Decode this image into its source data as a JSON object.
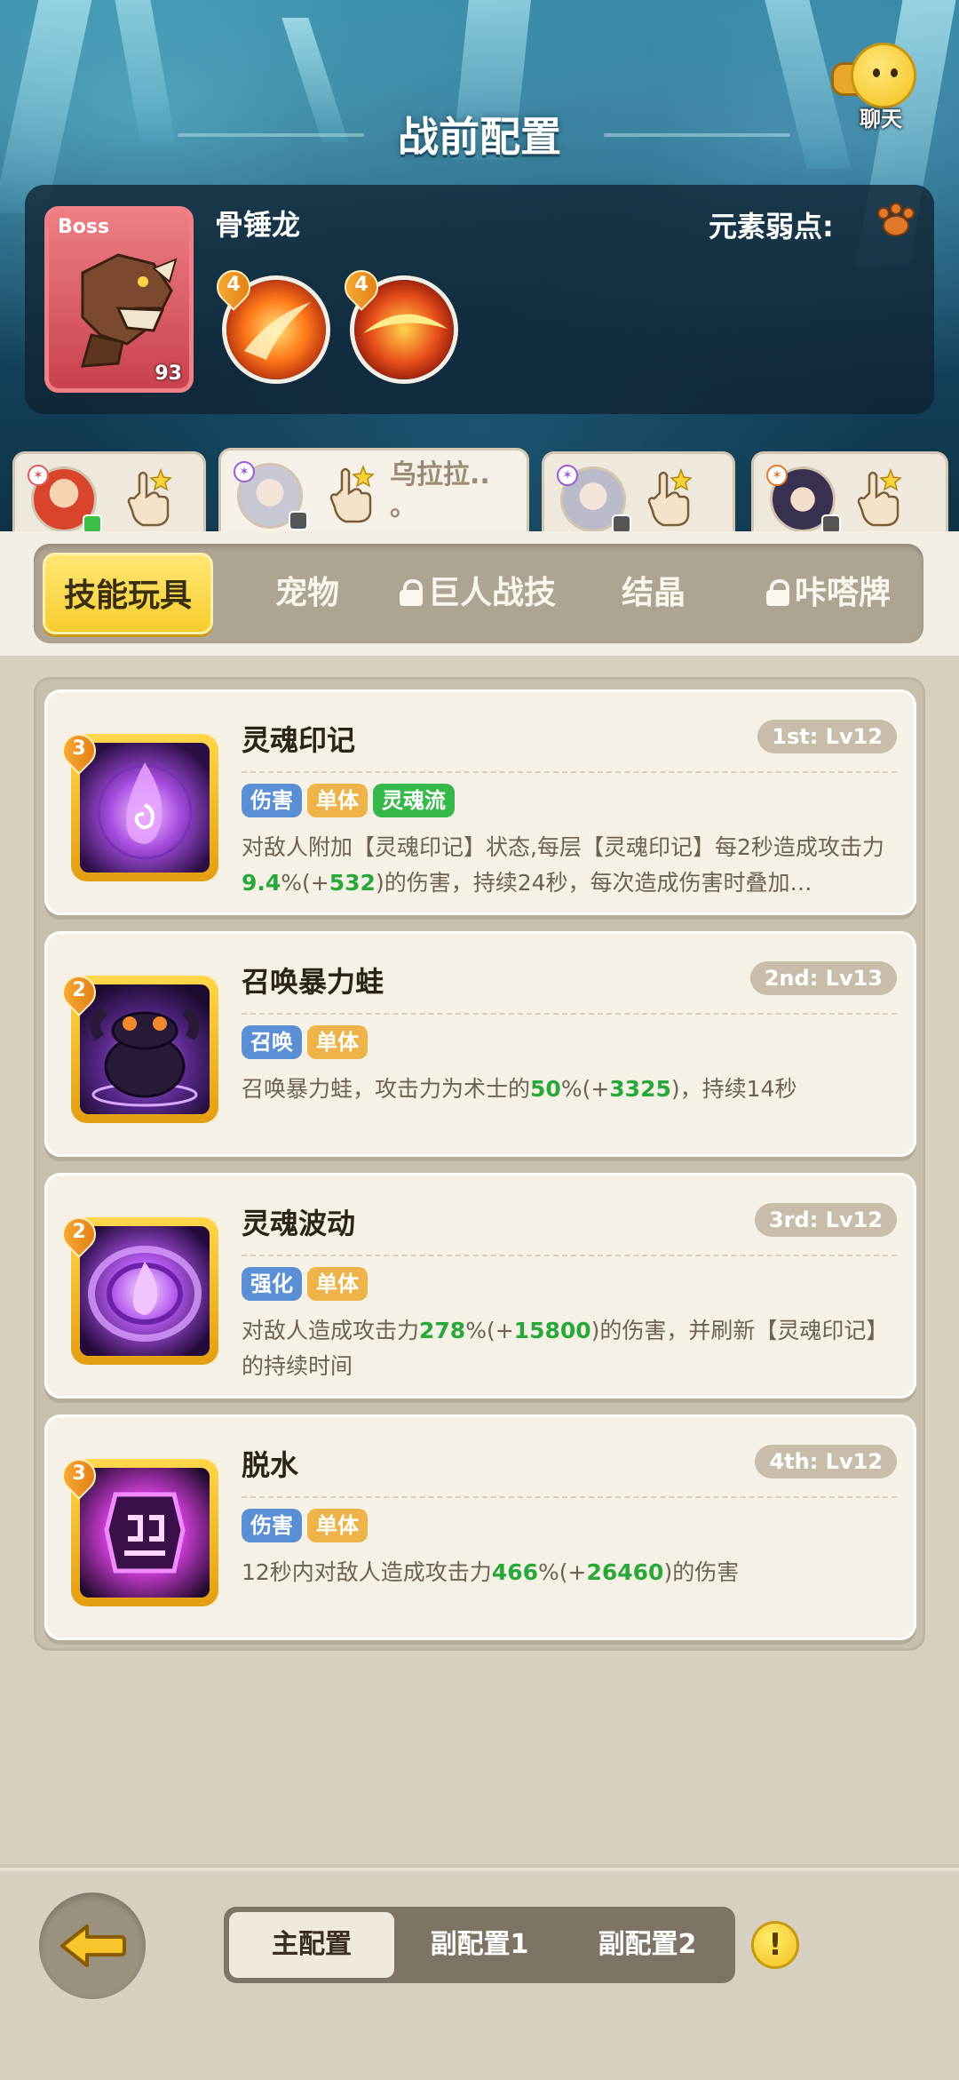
{
  "header": {
    "title": "战前配置",
    "chat_label": "聊天"
  },
  "boss": {
    "tag": "Boss",
    "name": "骨锤龙",
    "level": "93",
    "weakness_label": "元素弱点:",
    "skills": [
      {
        "rank": "4",
        "icon": "fire-claw-icon"
      },
      {
        "rank": "4",
        "icon": "fire-slash-icon"
      }
    ]
  },
  "heroes": [
    {
      "name": "",
      "active": false
    },
    {
      "name": "乌拉拉..\n。",
      "active": true
    },
    {
      "name": "",
      "active": false
    },
    {
      "name": "",
      "active": false
    }
  ],
  "categories": [
    {
      "label": "技能玩具",
      "active": true,
      "locked": false
    },
    {
      "label": "宠物",
      "active": false,
      "locked": false
    },
    {
      "label": "巨人战技",
      "active": false,
      "locked": true
    },
    {
      "label": "结晶",
      "active": false,
      "locked": false
    },
    {
      "label": "咔嗒牌",
      "active": false,
      "locked": true
    }
  ],
  "skills": [
    {
      "rank": "3",
      "name": "灵魂印记",
      "level": "1st: Lv12",
      "tags": [
        {
          "text": "伤害",
          "color": "blue"
        },
        {
          "text": "单体",
          "color": "orange"
        },
        {
          "text": "灵魂流",
          "color": "green"
        }
      ],
      "desc_parts": [
        "对敌人附加【灵魂印记】状态,每层【灵魂印记】每2秒造成攻击力",
        "9.4",
        "%(+",
        "532",
        ")的伤害，持续24秒，每次造成伤害时叠加…"
      ]
    },
    {
      "rank": "2",
      "name": "召唤暴力蛙",
      "level": "2nd: Lv13",
      "tags": [
        {
          "text": "召唤",
          "color": "blue"
        },
        {
          "text": "单体",
          "color": "orange"
        }
      ],
      "desc_parts": [
        "召唤暴力蛙，攻击力为术士的",
        "50",
        "%(+",
        "3325",
        ")，持续14秒"
      ]
    },
    {
      "rank": "2",
      "name": "灵魂波动",
      "level": "3rd: Lv12",
      "tags": [
        {
          "text": "强化",
          "color": "blue"
        },
        {
          "text": "单体",
          "color": "orange"
        }
      ],
      "desc_parts": [
        "对敌人造成攻击力",
        "278",
        "%(+",
        "15800",
        ")的伤害，并刷新【灵魂印记】的持续时间"
      ]
    },
    {
      "rank": "3",
      "name": "脱水",
      "level": "4th: Lv12",
      "tags": [
        {
          "text": "伤害",
          "color": "blue"
        },
        {
          "text": "单体",
          "color": "orange"
        }
      ],
      "desc_parts": [
        "12秒内对敌人造成攻击力",
        "466",
        "%(+",
        "26460",
        ")的伤害"
      ]
    }
  ],
  "configs": [
    {
      "label": "主配置",
      "active": true
    },
    {
      "label": "副配置1",
      "active": false
    },
    {
      "label": "副配置2",
      "active": false
    }
  ],
  "info_symbol": "!"
}
